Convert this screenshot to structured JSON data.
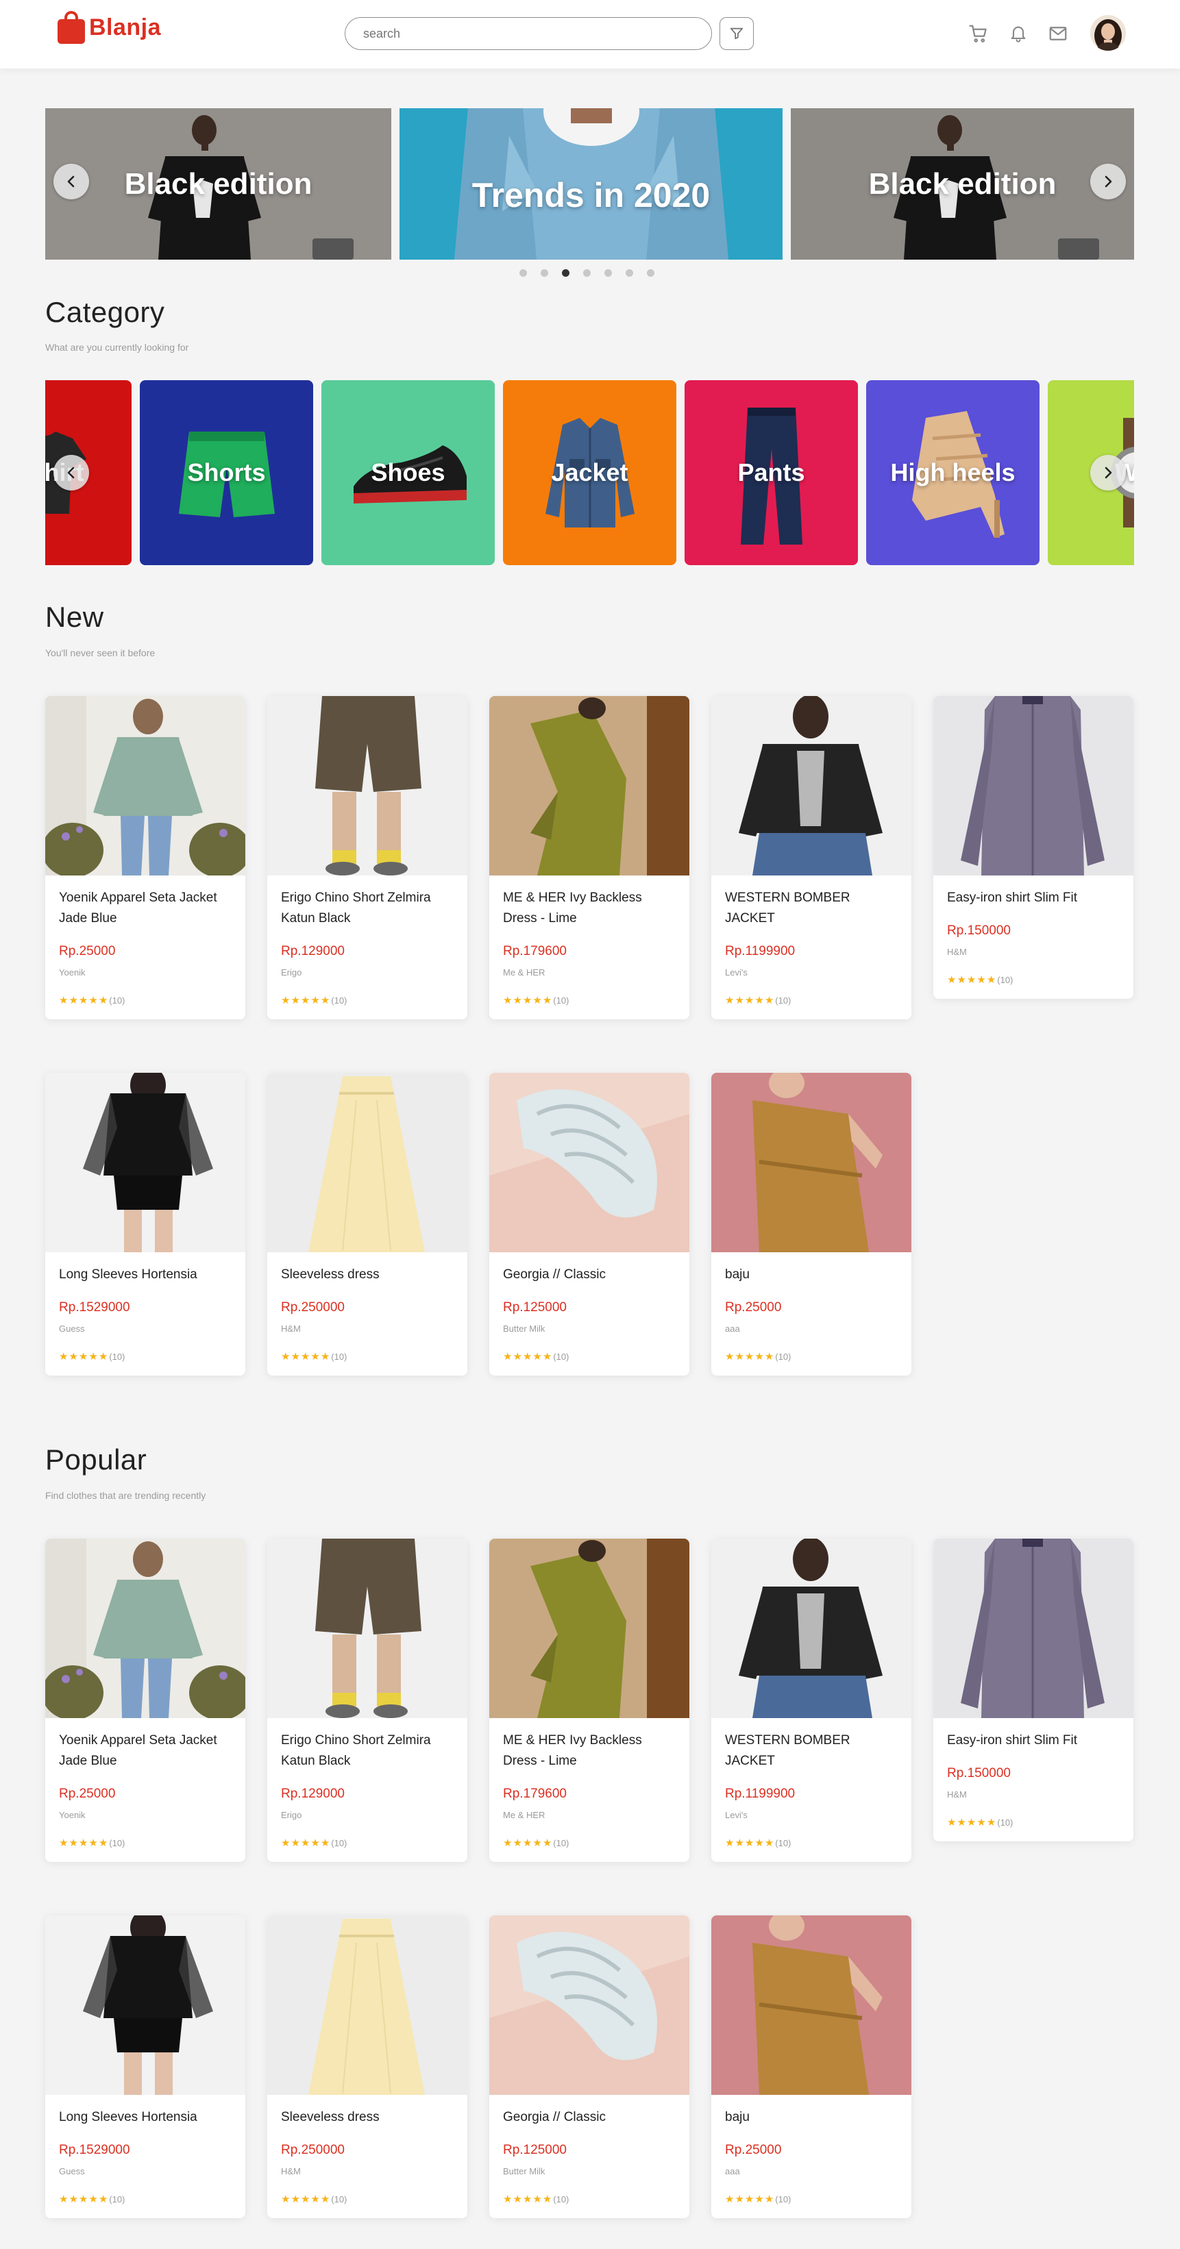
{
  "brand": {
    "name": "Blanja",
    "color": "#db3022"
  },
  "search": {
    "placeholder": "search"
  },
  "icons": {
    "filter": "filter-icon",
    "cart": "cart-icon",
    "bell": "bell-icon",
    "mail": "mail-icon"
  },
  "carousel": {
    "slides": [
      {
        "title": "Black edition"
      },
      {
        "title": "Trends in 2020"
      },
      {
        "title": "Black edition"
      }
    ],
    "dot_count": 7,
    "active_dot": 3
  },
  "category": {
    "title": "Category",
    "subtitle": "What are you currently looking for",
    "items": [
      {
        "label": "T-Shirt",
        "color": "#cf1111"
      },
      {
        "label": "Shorts",
        "color": "#1f2f9a"
      },
      {
        "label": "Shoes",
        "color": "#57cc99"
      },
      {
        "label": "Jacket",
        "color": "#f57c0a"
      },
      {
        "label": "Pants",
        "color": "#e21c50"
      },
      {
        "label": "High heels",
        "color": "#5a4fd8"
      },
      {
        "label": "Wr",
        "color": "#b4dc45"
      }
    ]
  },
  "new": {
    "title": "New",
    "subtitle": "You'll never seen it before",
    "products": [
      {
        "name": "Yoenik Apparel Seta Jacket Jade Blue",
        "price": "Rp.25000",
        "brand": "Yoenik",
        "rating": "(10)"
      },
      {
        "name": "Erigo Chino Short Zelmira Katun Black",
        "price": "Rp.129000",
        "brand": "Erigo",
        "rating": "(10)"
      },
      {
        "name": "ME & HER Ivy Backless Dress - Lime",
        "price": "Rp.179600",
        "brand": "Me & HER",
        "rating": "(10)"
      },
      {
        "name": "WESTERN BOMBER JACKET",
        "price": "Rp.1199900",
        "brand": "Levi's",
        "rating": "(10)"
      },
      {
        "name": "Easy-iron shirt Slim Fit",
        "price": "Rp.150000",
        "brand": "H&M",
        "rating": "(10)"
      },
      {
        "name": "Long Sleeves Hortensia",
        "price": "Rp.1529000",
        "brand": "Guess",
        "rating": "(10)"
      },
      {
        "name": "Sleeveless dress",
        "price": "Rp.250000",
        "brand": "H&M",
        "rating": "(10)"
      },
      {
        "name": "Georgia // Classic",
        "price": "Rp.125000",
        "brand": "Butter Milk",
        "rating": "(10)"
      },
      {
        "name": "baju",
        "price": "Rp.25000",
        "brand": "aaa",
        "rating": "(10)"
      }
    ]
  },
  "popular": {
    "title": "Popular",
    "subtitle": "Find clothes that are trending recently",
    "products": [
      {
        "name": "Yoenik Apparel Seta Jacket Jade Blue",
        "price": "Rp.25000",
        "brand": "Yoenik",
        "rating": "(10)"
      },
      {
        "name": "Erigo Chino Short Zelmira Katun Black",
        "price": "Rp.129000",
        "brand": "Erigo",
        "rating": "(10)"
      },
      {
        "name": "ME & HER Ivy Backless Dress - Lime",
        "price": "Rp.179600",
        "brand": "Me & HER",
        "rating": "(10)"
      },
      {
        "name": "WESTERN BOMBER JACKET",
        "price": "Rp.1199900",
        "brand": "Levi's",
        "rating": "(10)"
      },
      {
        "name": "Easy-iron shirt Slim Fit",
        "price": "Rp.150000",
        "brand": "H&M",
        "rating": "(10)"
      },
      {
        "name": "Long Sleeves Hortensia",
        "price": "Rp.1529000",
        "brand": "Guess",
        "rating": "(10)"
      },
      {
        "name": "Sleeveless dress",
        "price": "Rp.250000",
        "brand": "H&M",
        "rating": "(10)"
      },
      {
        "name": "Georgia // Classic",
        "price": "Rp.125000",
        "brand": "Butter Milk",
        "rating": "(10)"
      },
      {
        "name": "baju",
        "price": "Rp.25000",
        "brand": "aaa",
        "rating": "(10)"
      }
    ]
  }
}
